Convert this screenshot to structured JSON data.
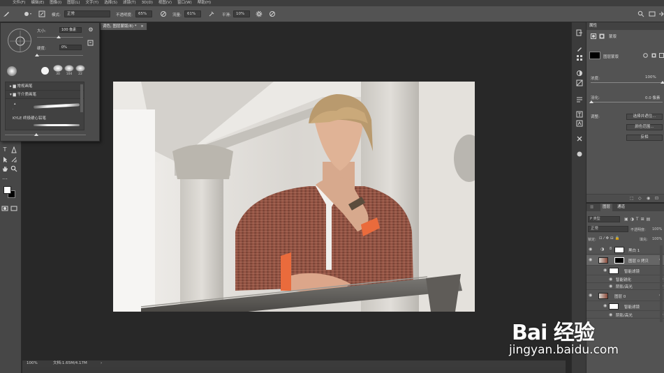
{
  "menu": {
    "items": [
      "文件(F)",
      "编辑(E)",
      "图像(I)",
      "图层(L)",
      "文字(Y)",
      "选择(S)",
      "滤镜(T)",
      "3D(D)",
      "视图(V)",
      "窗口(W)",
      "帮助(H)"
    ]
  },
  "options": {
    "mode_label": "模式:",
    "mode_value": "正常",
    "opacity_label": "不透明度:",
    "opacity_value": "65%",
    "flow_label": "流量:",
    "flow_value": "61%",
    "smooth_label": "平滑:",
    "smooth_value": "10%"
  },
  "brush_popup": {
    "size_label": "大小:",
    "size_value": "100 像素",
    "hardness_label": "硬度:",
    "hardness_value": "0%",
    "preset_sizes": [
      "30",
      "104",
      "22"
    ],
    "folder_general": "常规画笔",
    "folder_dry": "干介质画笔",
    "brush_name": "KYLE 终极硬心铅笔"
  },
  "document": {
    "tab_title": "调色, 图层蒙版/8) *",
    "zoom": "100%",
    "doc_info": "文档:1.65M/4.17M"
  },
  "properties": {
    "tab": "属性",
    "subtitle": "蒙版",
    "mask_label": "图层蒙版",
    "density_label": "浓度:",
    "density_value": "100%",
    "feather_label": "羽化:",
    "feather_value": "0.0 像素",
    "adjust_label": "调整:",
    "btn_select": "选择并遮住...",
    "btn_color_range": "颜色范围...",
    "btn_invert": "反相"
  },
  "layers": {
    "tabs": [
      "图层",
      "通道"
    ],
    "kind_label": "P 类型",
    "blend_mode": "正常",
    "opacity_label": "不透明度:",
    "opacity_value": "100%",
    "lock_label": "锁定:",
    "fill_label": "填充:",
    "fill_value": "100%",
    "rows": [
      {
        "name": "黑白 1"
      },
      {
        "name": "图层 0 拷贝"
      },
      {
        "name": "智能滤镜"
      },
      {
        "name": "智能锐化"
      },
      {
        "name": "阴影/高光"
      },
      {
        "name": "图层 0"
      },
      {
        "name": "智能滤镜"
      },
      {
        "name": "阴影/高光"
      }
    ]
  },
  "colors": {
    "menubar": "#3e3e3e",
    "options_bar": "#535353",
    "panel": "#535353",
    "canvas_bg": "#282828",
    "photo_bg": "#dedbd6",
    "shirt": "#8a4a3a",
    "accent": "#1473e6"
  },
  "watermark": {
    "brand": "Bai 经验",
    "url": "jingyan.baidu.com"
  }
}
